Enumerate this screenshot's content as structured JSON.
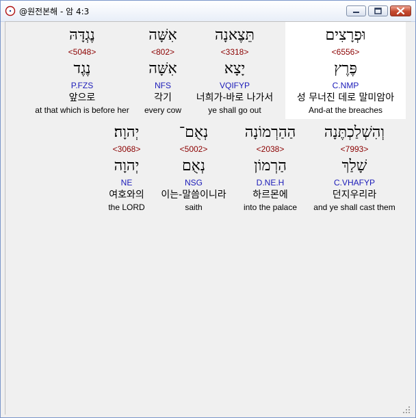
{
  "window": {
    "title": "@원전본해 - 암 4:3",
    "app_icon": "compass-icon",
    "controls": [
      "minimize-icon",
      "maximize-icon",
      "close-icon"
    ]
  },
  "rows": [
    [
      {
        "hebrew": "וּפְרָצִים",
        "strong": "<6556>",
        "root": "פֶּרֶץ",
        "parse": "C.NMP",
        "korean": "성 무너진 데로 말미암아",
        "english": "And-at the breaches",
        "selected": true
      },
      {
        "hebrew": "תֵּצֶאנָה",
        "strong": "<3318>",
        "root": "יָצָא",
        "parse": "VQIFYP",
        "korean": "너희가-바로 나가서",
        "english": "ye shall go out",
        "selected": false
      },
      {
        "hebrew": "אִשָּׁה",
        "strong": "<802>",
        "root": "אִשָּׁה",
        "parse": "NFS",
        "korean": "각기",
        "english": "every cow",
        "selected": false
      },
      {
        "hebrew": "נֶגְדָּהּ",
        "strong": "<5048>",
        "root": "נֶגֶד",
        "parse": "P.FZS",
        "korean": "앞으로",
        "english": "at that which is before her",
        "selected": false
      }
    ],
    [
      {
        "hebrew": "וְהִשְׁלַכְתֶּנָה",
        "strong": "<7993>",
        "root": "שָׁלַךְ",
        "parse": "C.VHAFYP",
        "korean": "던지우리라",
        "english": "and ye shall cast them",
        "selected": false
      },
      {
        "hebrew": "הַהַרְמוֹנָה",
        "strong": "<2038>",
        "root": "הַרְמוֹן",
        "parse": "D.NE.H",
        "korean": "하르몬에",
        "english": "into the palace",
        "selected": false
      },
      {
        "hebrew": "נְאֻם־",
        "strong": "<5002>",
        "root": "נְאֻם",
        "parse": "NSG",
        "korean": "이는-말씀이니라",
        "english": "saith",
        "selected": false
      },
      {
        "hebrew": "יְהוָה׃",
        "strong": "<3068>",
        "root": "יְהוָה",
        "parse": "NE",
        "korean": "여호와의",
        "english": "the LORD",
        "selected": false
      }
    ]
  ],
  "colors": {
    "strong": "#8b0000",
    "parse": "#1a1ab8",
    "selected_bg": "#ffffff",
    "content_bg": "#f0f0f0",
    "close_button": "#c44a2f"
  }
}
